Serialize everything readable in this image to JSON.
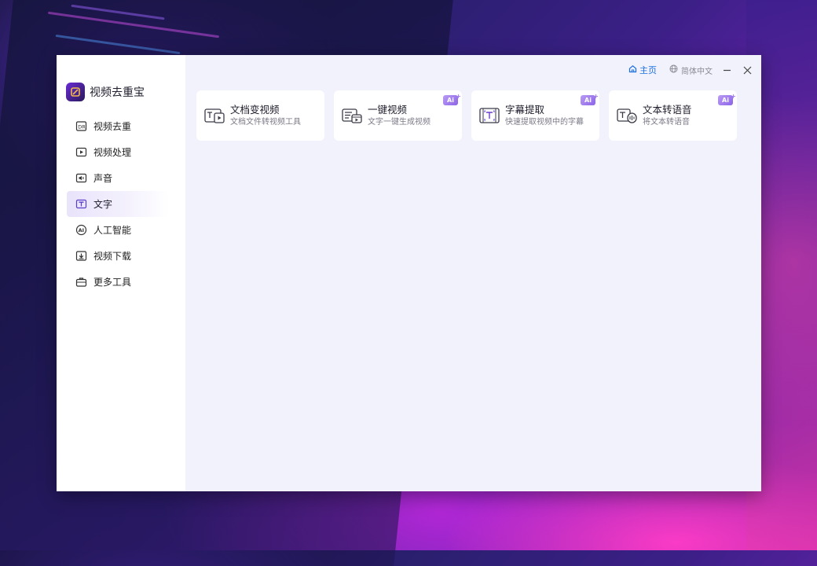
{
  "app": {
    "name": "视频去重宝"
  },
  "sidebar": {
    "items": [
      {
        "label": "视频去重",
        "icon": "video-dedupe-icon",
        "active": false
      },
      {
        "label": "视频处理",
        "icon": "video-play-icon",
        "active": false
      },
      {
        "label": "声音",
        "icon": "audio-icon",
        "active": false
      },
      {
        "label": "文字",
        "icon": "text-icon",
        "active": true
      },
      {
        "label": "人工智能",
        "icon": "ai-icon",
        "active": false
      },
      {
        "label": "视频下载",
        "icon": "download-icon",
        "active": false
      },
      {
        "label": "更多工具",
        "icon": "toolbox-icon",
        "active": false
      }
    ]
  },
  "topbar": {
    "home_label": "主页",
    "language_label": "简体中文"
  },
  "cards": [
    {
      "title": "文档变视频",
      "subtitle": "文档文件转视频工具",
      "icon": "doc-to-video-icon",
      "ai": false
    },
    {
      "title": "一键视频",
      "subtitle": "文字一键生成视频",
      "icon": "one-click-video-icon",
      "ai": true,
      "badge": "Ai"
    },
    {
      "title": "字幕提取",
      "subtitle": "快速提取视频中的字幕",
      "icon": "subtitle-extract-icon",
      "ai": true,
      "badge": "Ai"
    },
    {
      "title": "文本转语音",
      "subtitle": "将文本转语音",
      "icon": "text-to-speech-icon",
      "ai": true,
      "badge": "Ai"
    }
  ],
  "colors": {
    "accent": "#1a6fe0",
    "brand_purple": "#6a2bd6",
    "ai_badge": "#8c63e8",
    "window_bg": "#f1f2fb",
    "sidebar_active": "#e9e3fb"
  }
}
